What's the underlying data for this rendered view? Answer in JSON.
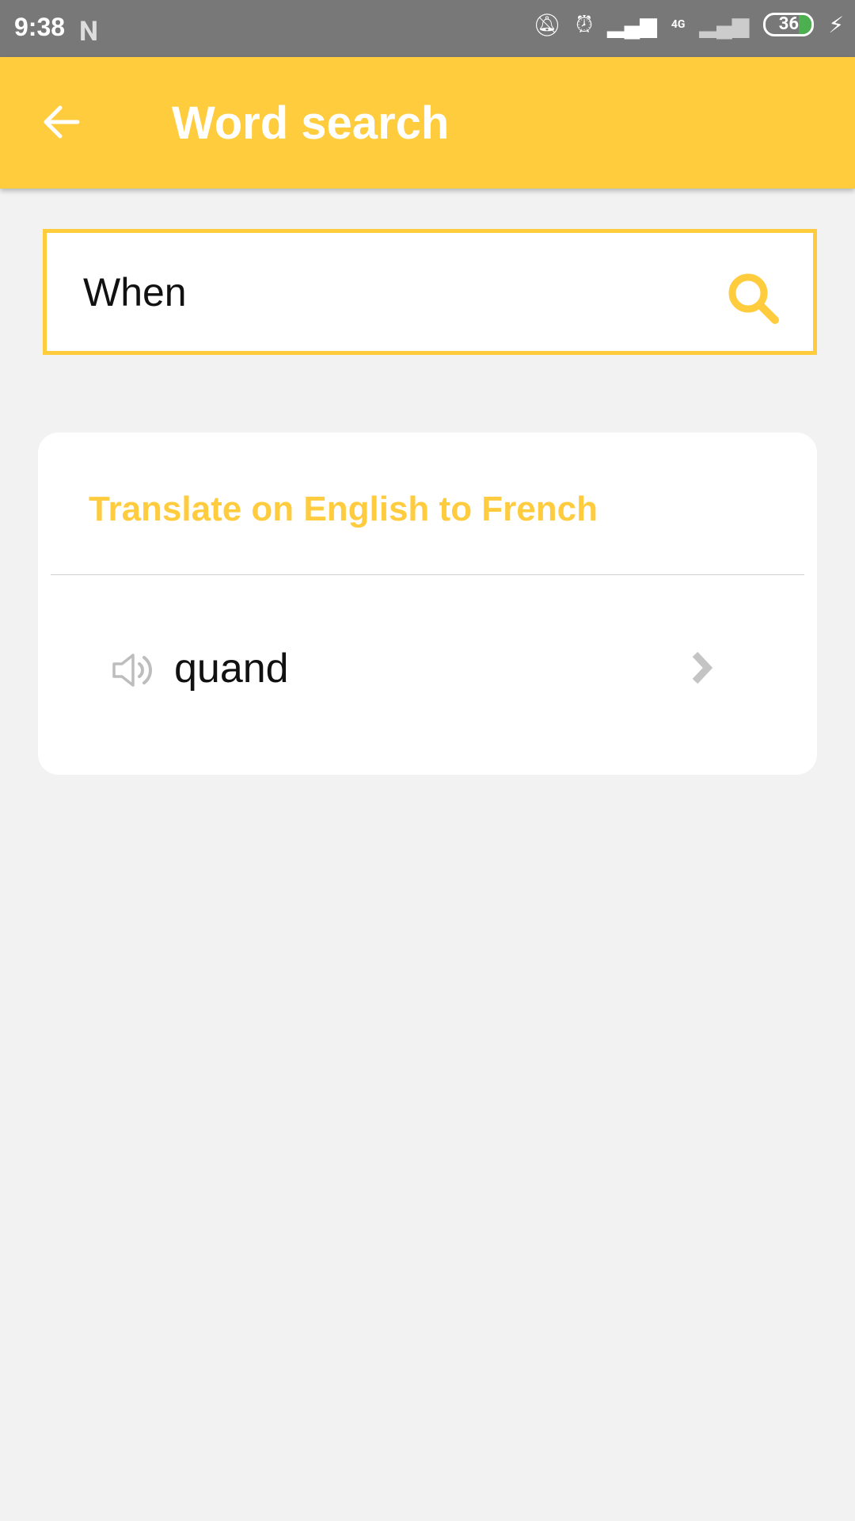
{
  "status_bar": {
    "time": "9:38",
    "network": "4G",
    "battery": "36"
  },
  "app_bar": {
    "title": "Word search",
    "back_icon": "arrow-left-icon"
  },
  "search": {
    "value": "When",
    "icon": "search-icon"
  },
  "result_card": {
    "title": "Translate on English to French",
    "items": [
      {
        "word": "quand",
        "icon": "speaker-icon"
      }
    ]
  },
  "colors": {
    "accent": "#ffcc3d",
    "background": "#f2f2f2",
    "status_bar": "#787878"
  }
}
